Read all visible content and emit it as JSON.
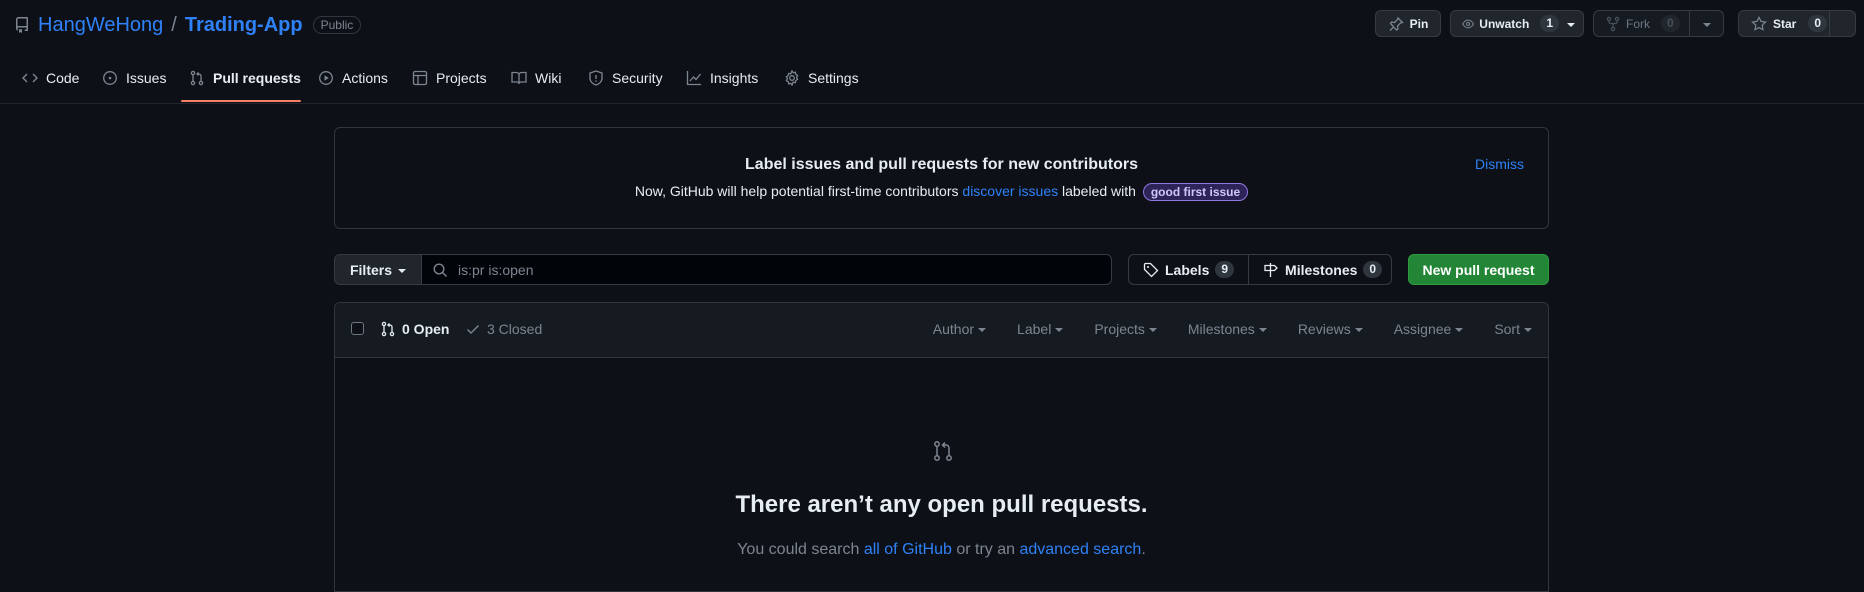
{
  "repo": {
    "owner": "HangWeHong",
    "separator": "/",
    "name": "Trading-App",
    "visibility": "Public"
  },
  "actions": {
    "pin": "Pin",
    "unwatch": "Unwatch",
    "unwatch_count": "1",
    "fork": "Fork",
    "fork_count": "0",
    "star": "Star",
    "star_count": "0"
  },
  "nav": [
    {
      "label": "Code",
      "icon": "code-icon"
    },
    {
      "label": "Issues",
      "icon": "issue-icon"
    },
    {
      "label": "Pull requests",
      "icon": "pull-request-icon",
      "selected": true
    },
    {
      "label": "Actions",
      "icon": "play-icon"
    },
    {
      "label": "Projects",
      "icon": "table-icon"
    },
    {
      "label": "Wiki",
      "icon": "book-icon"
    },
    {
      "label": "Security",
      "icon": "shield-icon"
    },
    {
      "label": "Insights",
      "icon": "graph-icon"
    },
    {
      "label": "Settings",
      "icon": "gear-icon"
    }
  ],
  "banner": {
    "title": "Label issues and pull requests for new contributors",
    "text_before": "Now, GitHub will help potential first-time contributors ",
    "link": "discover issues",
    "text_after": " labeled with ",
    "label": "good first issue",
    "dismiss": "Dismiss"
  },
  "filters": {
    "label": "Filters",
    "search_value": "is:pr is:open"
  },
  "labels": {
    "label": "Labels",
    "count": "9"
  },
  "milestones": {
    "label": "Milestones",
    "count": "0"
  },
  "new_pr": "New pull request",
  "list": {
    "open": "0 Open",
    "closed": "3 Closed",
    "sort_menu": [
      "Author",
      "Label",
      "Projects",
      "Milestones",
      "Reviews",
      "Assignee",
      "Sort"
    ]
  },
  "blank": {
    "title": "There aren’t any open pull requests.",
    "text_before": "You could search ",
    "link1": "all of GitHub",
    "text_middle": " or try an ",
    "link2": "advanced search",
    "text_after": "."
  },
  "colors": {
    "accent": "#2f81f7",
    "selected_tab": "#f78166",
    "primary_button": "#238636",
    "label_purple": "#8e76e0"
  }
}
